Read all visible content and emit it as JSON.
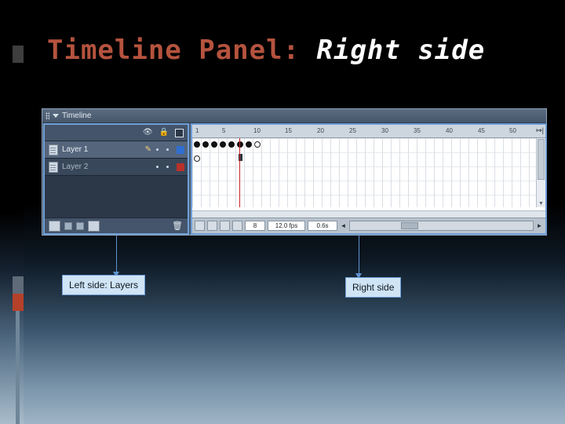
{
  "slide": {
    "title_main": "Timeline Panel: ",
    "title_sub": "Right side"
  },
  "timeline_window": {
    "titlebar": {
      "label": "Timeline",
      "grip_icon": "drag-grip-icon",
      "caret_icon": "chevron-down-icon"
    },
    "layers_panel": {
      "header_icons": [
        "eye-icon",
        "lock-icon",
        "outline-square-icon"
      ],
      "layers": [
        {
          "name": "Layer 1",
          "selected": true,
          "pencil": "pencil-icon",
          "color": "#2f6fd0"
        },
        {
          "name": "Layer 2",
          "selected": false,
          "pencil": "",
          "color": "#b8312a"
        }
      ],
      "footer_buttons": [
        "new-layer-icon",
        "new-folder-icon",
        "delete-layer-icon",
        "trash-icon"
      ]
    },
    "frames_panel": {
      "ruler_ticks": [
        "1",
        "5",
        "10",
        "15",
        "20",
        "25",
        "30",
        "35",
        "40",
        "45",
        "50"
      ],
      "ruler_end_icon": "center-frame-icon",
      "keyframes_row1": [
        "filled",
        "filled",
        "filled",
        "filled",
        "filled",
        "filled",
        "filled",
        "hollow"
      ],
      "keyframes_row2": [
        "hollow"
      ],
      "playhead_frame": 8,
      "status_bar": {
        "current_frame": "8",
        "frame_rate": "12.0 fps",
        "elapsed_time": "0.6s",
        "buttons": [
          "onion-skin-icon",
          "onion-skin-outlines-icon",
          "edit-multiple-frames-icon",
          "modify-onion-markers-icon"
        ],
        "scroll_left_arrow": "◄",
        "scroll_right_arrow": "►"
      }
    }
  },
  "callouts": {
    "left_label": "Left side: Layers",
    "right_label": "Right side"
  }
}
